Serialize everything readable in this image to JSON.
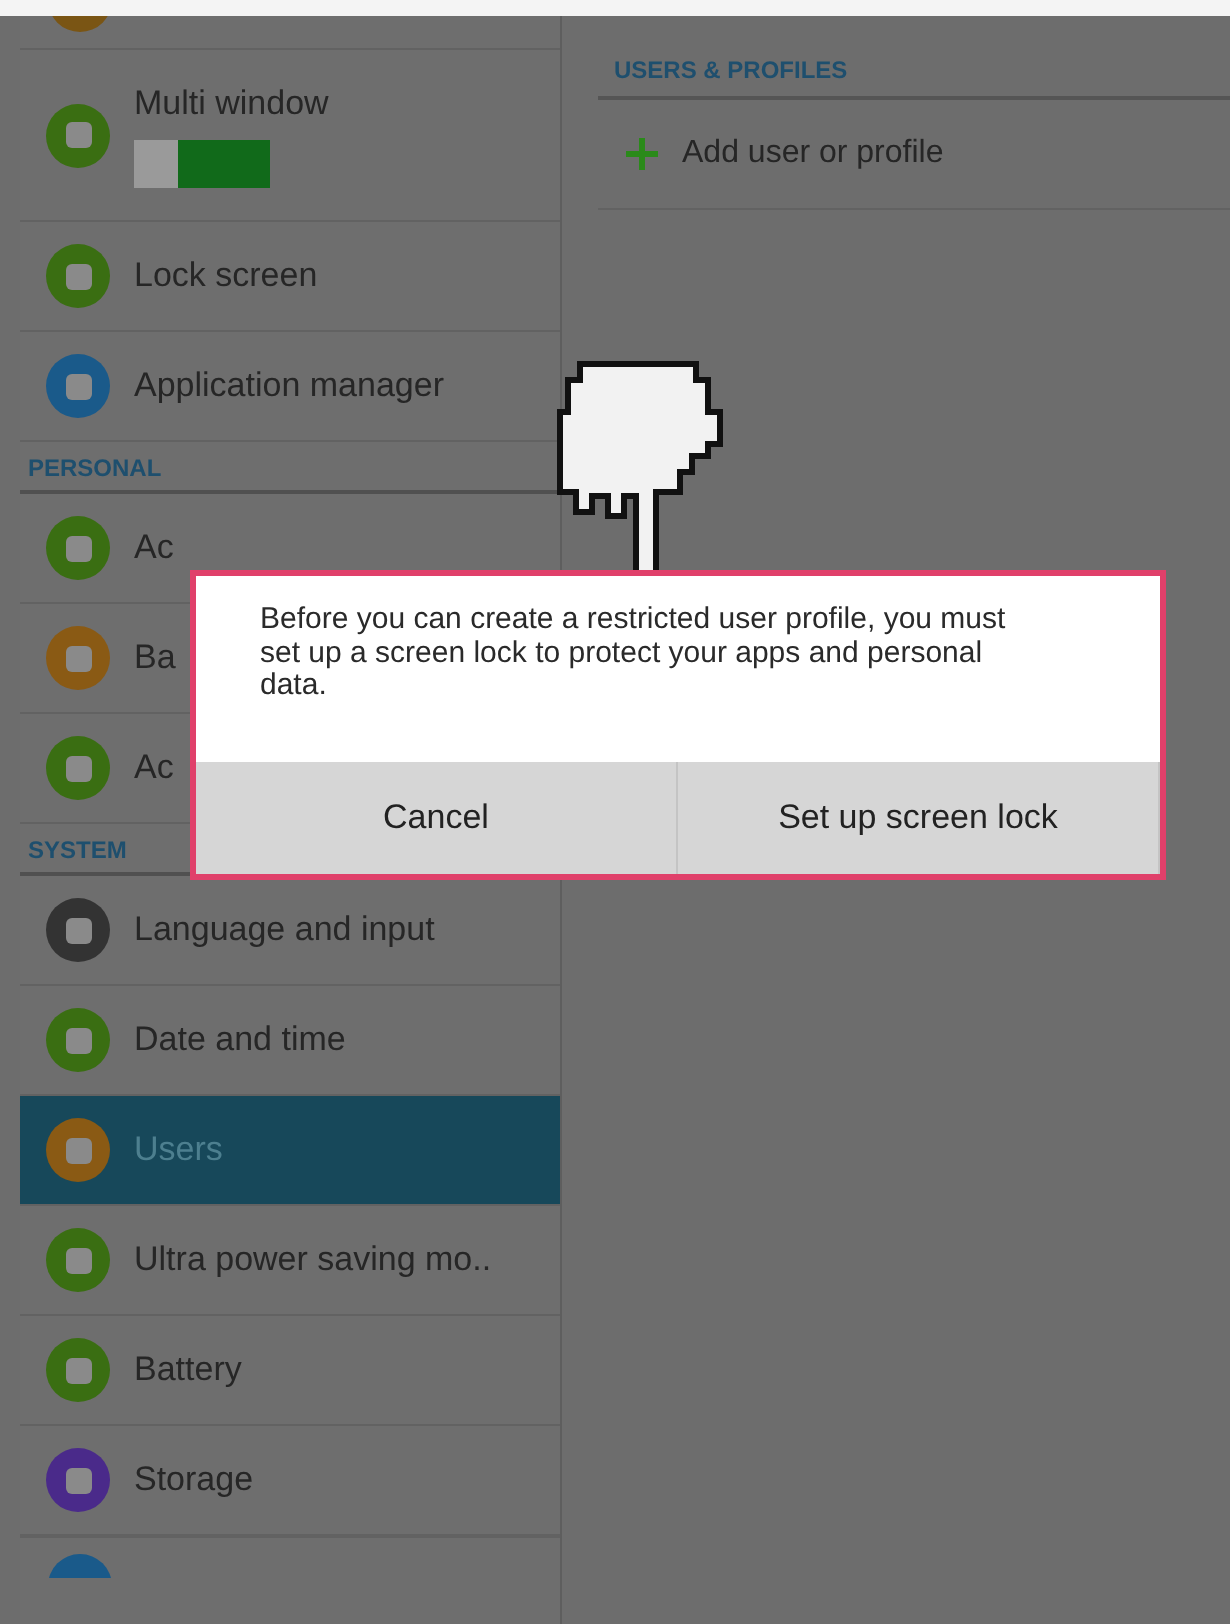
{
  "sidebar": {
    "items": [
      {
        "kind": "toggle",
        "label": "Multi window",
        "color": "#3a6e12",
        "on": true,
        "selected": false
      },
      {
        "kind": "setting",
        "label": "Lock screen",
        "color": "#3a6e12",
        "selected": false
      },
      {
        "kind": "setting",
        "label": "Application manager",
        "color": "#1a5a8a",
        "selected": false
      },
      {
        "kind": "header",
        "label": "PERSONAL"
      },
      {
        "kind": "setting",
        "label": "Ac",
        "color": "#3a6e12",
        "selected": false
      },
      {
        "kind": "setting",
        "label": "Ba",
        "color": "#8a5a14",
        "selected": false
      },
      {
        "kind": "setting",
        "label": "Ac",
        "color": "#3a6e12",
        "selected": false
      },
      {
        "kind": "header",
        "label": "SYSTEM"
      },
      {
        "kind": "setting",
        "label": "Language and input",
        "color": "#333333",
        "selected": false
      },
      {
        "kind": "setting",
        "label": "Date and time",
        "color": "#3a6e12",
        "selected": false
      },
      {
        "kind": "setting",
        "label": "Users",
        "color": "#8a5a14",
        "selected": true
      },
      {
        "kind": "setting",
        "label": "Ultra power saving mo..",
        "color": "#3a6e12",
        "selected": false
      },
      {
        "kind": "setting",
        "label": "Battery",
        "color": "#3a6e12",
        "selected": false
      },
      {
        "kind": "setting",
        "label": "Storage",
        "color": "#4a2a8a",
        "selected": false
      }
    ]
  },
  "detail": {
    "header": "USERS & PROFILES",
    "add_label": "Add user or profile"
  },
  "dialog": {
    "message": "Before you can create a restricted user profile, you must set up a screen lock to protect your apps and personal data.",
    "buttons": [
      "Cancel",
      "Set up screen lock"
    ]
  }
}
